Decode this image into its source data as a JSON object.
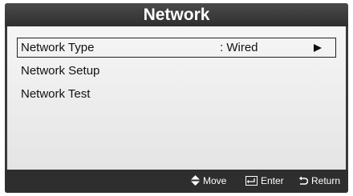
{
  "window": {
    "title": "Network"
  },
  "menu": {
    "items": [
      {
        "label": "Network Type",
        "value": ": Wired",
        "selected": true
      },
      {
        "label": "Network Setup"
      },
      {
        "label": "Network Test"
      }
    ]
  },
  "footer": {
    "move_label": "Move",
    "enter_label": "Enter",
    "return_label": "Return"
  },
  "icons": {
    "move": "up-down-arrows-icon",
    "enter": "enter-key-icon",
    "return": "return-arrow-icon",
    "submenu": "arrow-right-icon"
  },
  "colors": {
    "frame": "#3a3a3a",
    "content_background": "#ececec",
    "text": "#111111",
    "footer_text": "#ffffff"
  }
}
